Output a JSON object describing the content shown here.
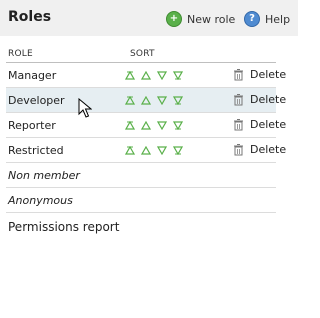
{
  "header": {
    "title": "Roles",
    "new_role_label": "New role",
    "help_label": "Help"
  },
  "table": {
    "headers": {
      "role": "ROLE",
      "sort": "SORT"
    },
    "rows": [
      {
        "name": "Manager",
        "delete_label": "Delete"
      },
      {
        "name": "Developer",
        "delete_label": "Delete"
      },
      {
        "name": "Reporter",
        "delete_label": "Delete"
      },
      {
        "name": "Restricted",
        "delete_label": "Delete"
      }
    ],
    "builtin_rows": [
      {
        "name": "Non member"
      },
      {
        "name": "Anonymous"
      }
    ]
  },
  "footer": {
    "report_link": "Permissions report"
  },
  "colors": {
    "accent_green": "#5ab04a",
    "help_blue": "#4f8bd1",
    "hover_row": "#e6eef2"
  }
}
